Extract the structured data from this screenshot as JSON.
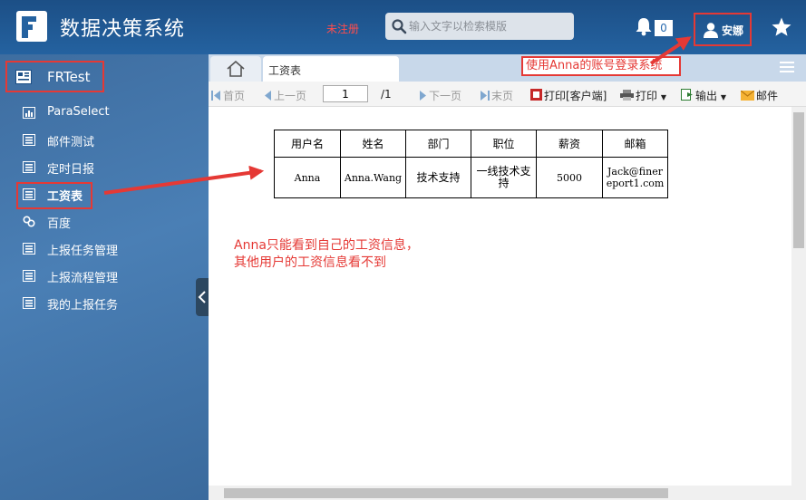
{
  "header": {
    "app_title": "数据决策系统",
    "unregistered": "未注册",
    "search_placeholder": "输入文字以检索模版",
    "notification_count": "0",
    "user_name": "安娜"
  },
  "sidebar": {
    "root": "FRTest",
    "items": [
      {
        "label": "ParaSelect"
      },
      {
        "label": "邮件测试"
      },
      {
        "label": "定时日报"
      },
      {
        "label": "工资表"
      },
      {
        "label": "百度"
      },
      {
        "label": "上报任务管理"
      },
      {
        "label": "上报流程管理"
      },
      {
        "label": "我的上报任务"
      }
    ]
  },
  "tabs": {
    "active": "工资表"
  },
  "toolbar": {
    "first": "首页",
    "prev": "上一页",
    "page_value": "1",
    "page_total": "/1",
    "next": "下一页",
    "last": "末页",
    "print_client": "打印[客户端]",
    "print": "打印",
    "export": "输出",
    "mail": "邮件"
  },
  "report": {
    "headers": [
      "用户名",
      "姓名",
      "部门",
      "职位",
      "薪资",
      "邮箱"
    ],
    "row": [
      "Anna",
      "Anna.Wang",
      "技术支持",
      "一线技术支持",
      "5000",
      "Jack@finereport1.com"
    ]
  },
  "annotations": {
    "login_note": "使用Anna的账号登录系统",
    "info_note_line1": "Anna只能看到自己的工资信息，",
    "info_note_line2": "其他用户的工资信息看不到"
  },
  "colors": {
    "header_bg": "#2462a0",
    "sidebar_bg": "#4a7fb5",
    "annotation_red": "#e53935"
  }
}
